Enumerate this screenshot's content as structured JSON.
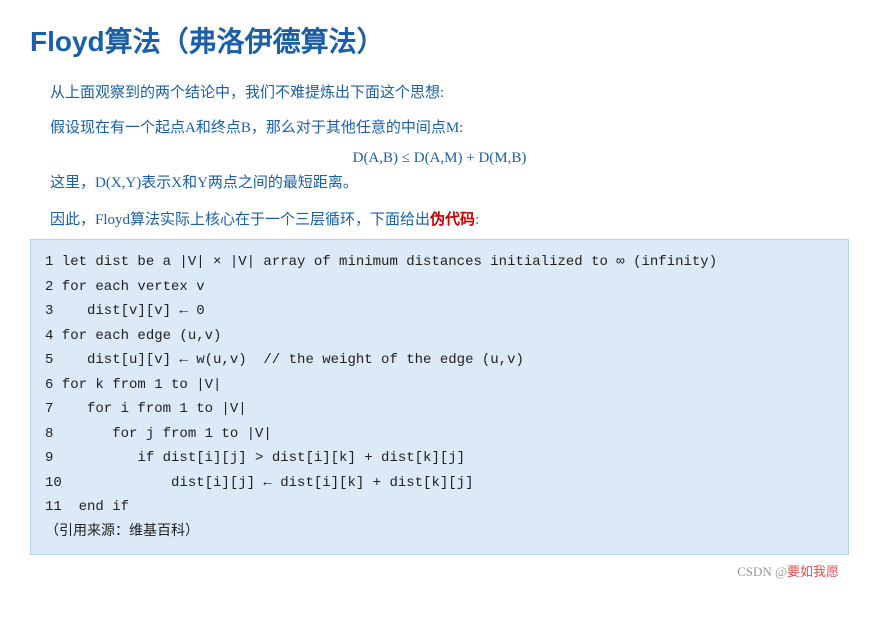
{
  "title": "Floyd算法（弗洛伊德算法）",
  "intro": {
    "line1": "从上面观察到的两个结论中，我们不难提炼出下面这个思想:",
    "line2": "假设现在有一个起点A和终点B，那么对于其他任意的中间点M:",
    "formula": "D(A,B) ≤ D(A,M) + D(M,B)",
    "note": "这里，D(X,Y)表示X和Y两点之间的最短距离。"
  },
  "summary": {
    "prefix": "因此，Floyd算法实际上核心在于一个三层循环，下面给出",
    "highlight": "伪代码",
    "suffix": ":"
  },
  "code": {
    "lines": [
      "1 let dist be a |V| × |V| array of minimum distances initialized to ∞ (infinity)",
      "2 for each vertex v",
      "3    dist[v][v] ← 0",
      "4 for each edge (u,v)",
      "5    dist[u][v] ← w(u,v)  // the weight of the edge (u,v)",
      "6 for k from 1 to |V|",
      "7    for i from 1 to |V|",
      "8       for j from 1 to |V|",
      "9          if dist[i][j] > dist[i][k] + dist[k][j]",
      "10             dist[i][j] ← dist[i][k] + dist[k][j]",
      "11  end if",
      "（引用来源：维基百科）"
    ]
  },
  "footer": {
    "prefix": "CSDN @",
    "brand": "要如我愿"
  }
}
